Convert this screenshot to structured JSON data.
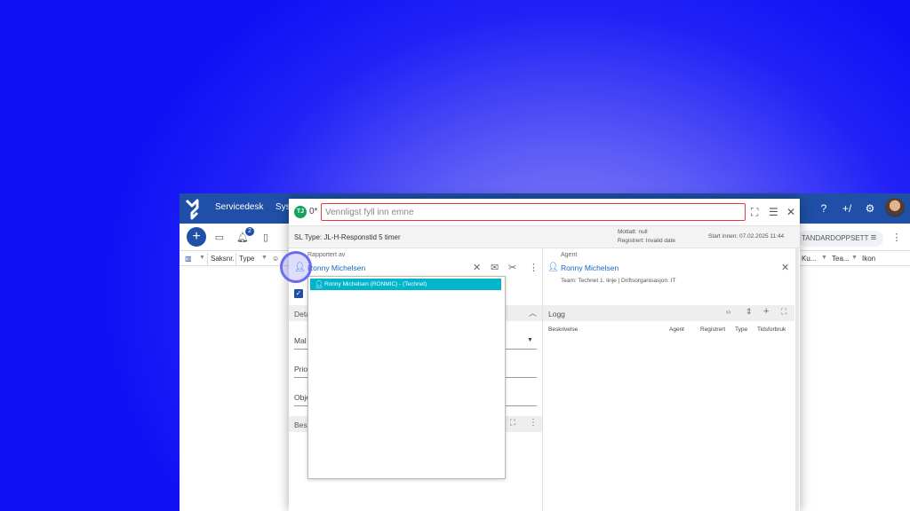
{
  "app": {
    "nav": [
      "Servicedesk",
      "Sys"
    ],
    "notification_count": "2",
    "standard_layout": "TANDARDOPPSETT",
    "columns": [
      "Saksnr.",
      "Type",
      "Ku...",
      "Tea...",
      "Ikon"
    ],
    "colors": {
      "topbar": "#1f4fa6",
      "accent": "#1f4fa6"
    }
  },
  "dialog": {
    "avatar_initials": "TJ",
    "case_number": "0*",
    "subject_placeholder": "Vennligst fyll inn emne",
    "sl_type": "SL Type: JL-H-Responstid 5 timer",
    "received": "Mottatt: null",
    "registered": "Registrert: Invalid date",
    "start_by": "Start innen: 07.02.2025 11:44",
    "reported_by_label": "Rapportert av",
    "reported_by_name": "Ronny Michelsen",
    "agent_label": "Agent",
    "agent_name": "Ronny Michelsen",
    "agent_team": "Team: Technet 1. linje | Driftsorganisasjon: IT",
    "sections": {
      "details": "Deta",
      "description": "Besk",
      "log": "Logg"
    },
    "fields": [
      "Mal",
      "Prio",
      "Obje"
    ],
    "log_columns": [
      "Beskrivelse",
      "Agent",
      "Registrert",
      "Type",
      "Tidsforbruk"
    ],
    "dropdown_items": [
      "Ronny Michelsen (RONMIC) - (Technet)"
    ]
  }
}
